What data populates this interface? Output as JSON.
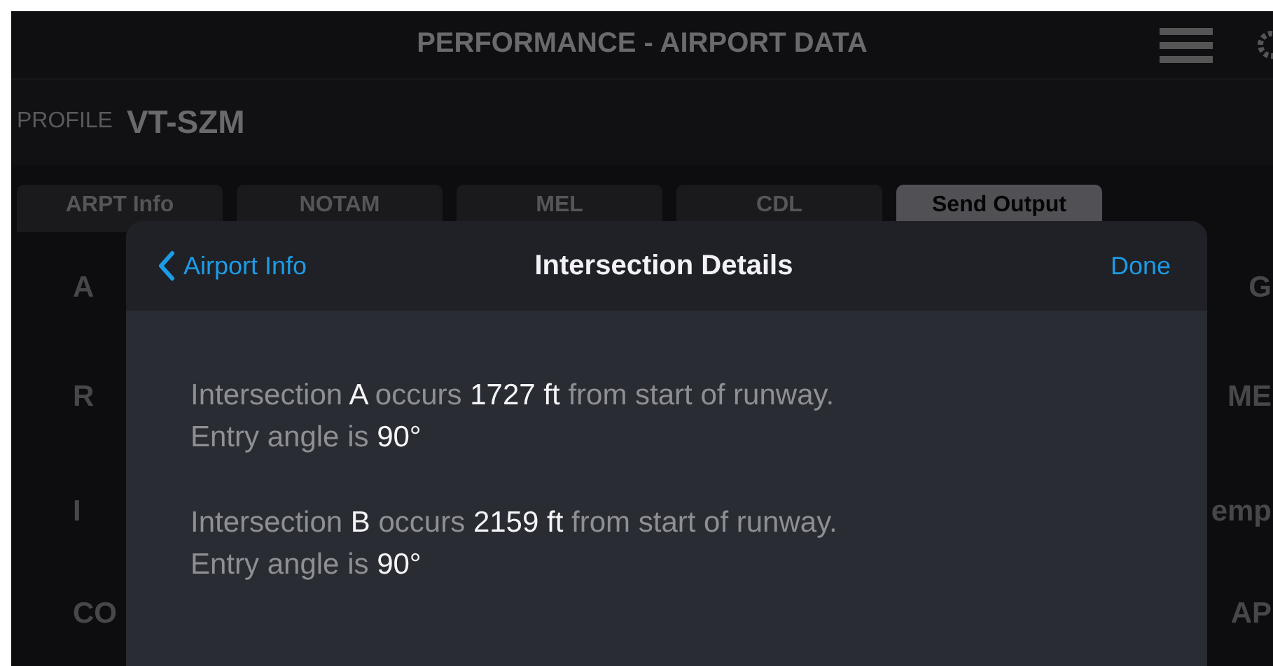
{
  "header": {
    "title": "PERFORMANCE - AIRPORT DATA"
  },
  "profile": {
    "label": "PROFILE",
    "value": "VT-SZM"
  },
  "tabs": [
    {
      "label": "ARPT Info",
      "selected": false
    },
    {
      "label": "NOTAM",
      "selected": false
    },
    {
      "label": "MEL",
      "selected": false
    },
    {
      "label": "CDL",
      "selected": false
    },
    {
      "label": "Send Output",
      "selected": true
    }
  ],
  "background_rows": [
    {
      "left": "A",
      "right": "G"
    },
    {
      "left": "R",
      "right": "ME"
    },
    {
      "left": "I",
      "right": "emp"
    },
    {
      "left": "CO",
      "right": "AP"
    }
  ],
  "modal": {
    "back": "Airport Info",
    "title": "Intersection Details",
    "done": "Done",
    "paragraphs": [
      {
        "lines": [
          [
            {
              "text": "Intersection ",
              "emphasis": false
            },
            {
              "text": "A",
              "emphasis": true
            },
            {
              "text": " occurs ",
              "emphasis": false
            },
            {
              "text": "1727 ft",
              "emphasis": true
            },
            {
              "text": " from start of runway.",
              "emphasis": false
            }
          ],
          [
            {
              "text": "Entry angle is ",
              "emphasis": false
            },
            {
              "text": "90°",
              "emphasis": true
            }
          ]
        ]
      },
      {
        "lines": [
          [
            {
              "text": "Intersection ",
              "emphasis": false
            },
            {
              "text": "B",
              "emphasis": true
            },
            {
              "text": " occurs ",
              "emphasis": false
            },
            {
              "text": "2159 ft",
              "emphasis": true
            },
            {
              "text": " from start of runway.",
              "emphasis": false
            }
          ],
          [
            {
              "text": "Entry angle is ",
              "emphasis": false
            },
            {
              "text": "90°",
              "emphasis": true
            }
          ]
        ]
      }
    ]
  }
}
